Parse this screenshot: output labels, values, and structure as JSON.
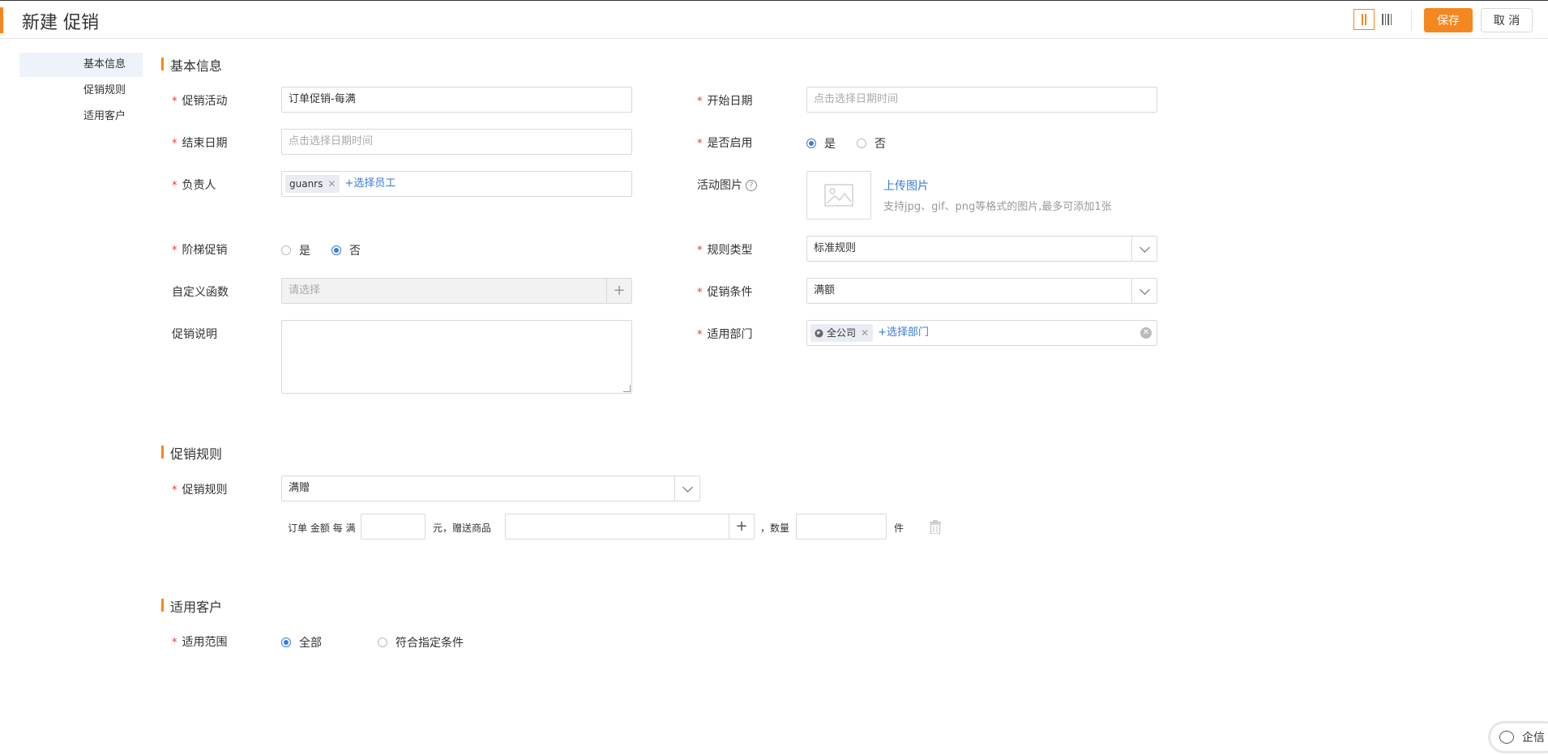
{
  "header": {
    "title": "新建 促销",
    "save_label": "保存",
    "cancel_label": "取 消",
    "accent_color": "#f5871f"
  },
  "sidenav": {
    "items": [
      {
        "label": "基本信息",
        "active": true
      },
      {
        "label": "促销规则",
        "active": false
      },
      {
        "label": "适用客户",
        "active": false
      }
    ]
  },
  "basic": {
    "section_title": "基本信息",
    "promo_activity": {
      "label": "促销活动",
      "value": "订单促销-每满"
    },
    "start_date": {
      "label": "开始日期",
      "placeholder": "点击选择日期时间"
    },
    "end_date": {
      "label": "结束日期",
      "placeholder": "点击选择日期时间"
    },
    "enabled": {
      "label": "是否启用",
      "options": [
        "是",
        "否"
      ],
      "selected": "是"
    },
    "owner": {
      "label": "负责人",
      "tag": "guanrs",
      "add_link": "+选择员工"
    },
    "activity_image": {
      "label": "活动图片",
      "upload_link": "上传图片",
      "hint": "支持jpg、gif、png等格式的图片,最多可添加1张"
    },
    "tiered": {
      "label": "阶梯促销",
      "options": [
        "是",
        "否"
      ],
      "selected": "否"
    },
    "rule_type": {
      "label": "规则类型",
      "value": "标准规则"
    },
    "custom_func": {
      "label": "自定义函数",
      "placeholder": "请选择"
    },
    "promo_condition": {
      "label": "促销条件",
      "value": "满额"
    },
    "description": {
      "label": "促销说明"
    },
    "departments": {
      "label": "适用部门",
      "tag": "全公司",
      "add_link": "+选择部门"
    }
  },
  "rules": {
    "section_title": "促销规则",
    "promo_rule": {
      "label": "促销规则",
      "value": "满赠"
    },
    "row": {
      "prefix": "订单 金额 每 满",
      "unit_yuan": "元，赠送商品",
      "qty_label": "，数量",
      "unit_jian": "件"
    }
  },
  "customers": {
    "section_title": "适用客户",
    "scope": {
      "label": "适用范围",
      "options": [
        "全部",
        "符合指定条件"
      ],
      "selected": "全部"
    }
  },
  "chat": {
    "label": "企信"
  }
}
